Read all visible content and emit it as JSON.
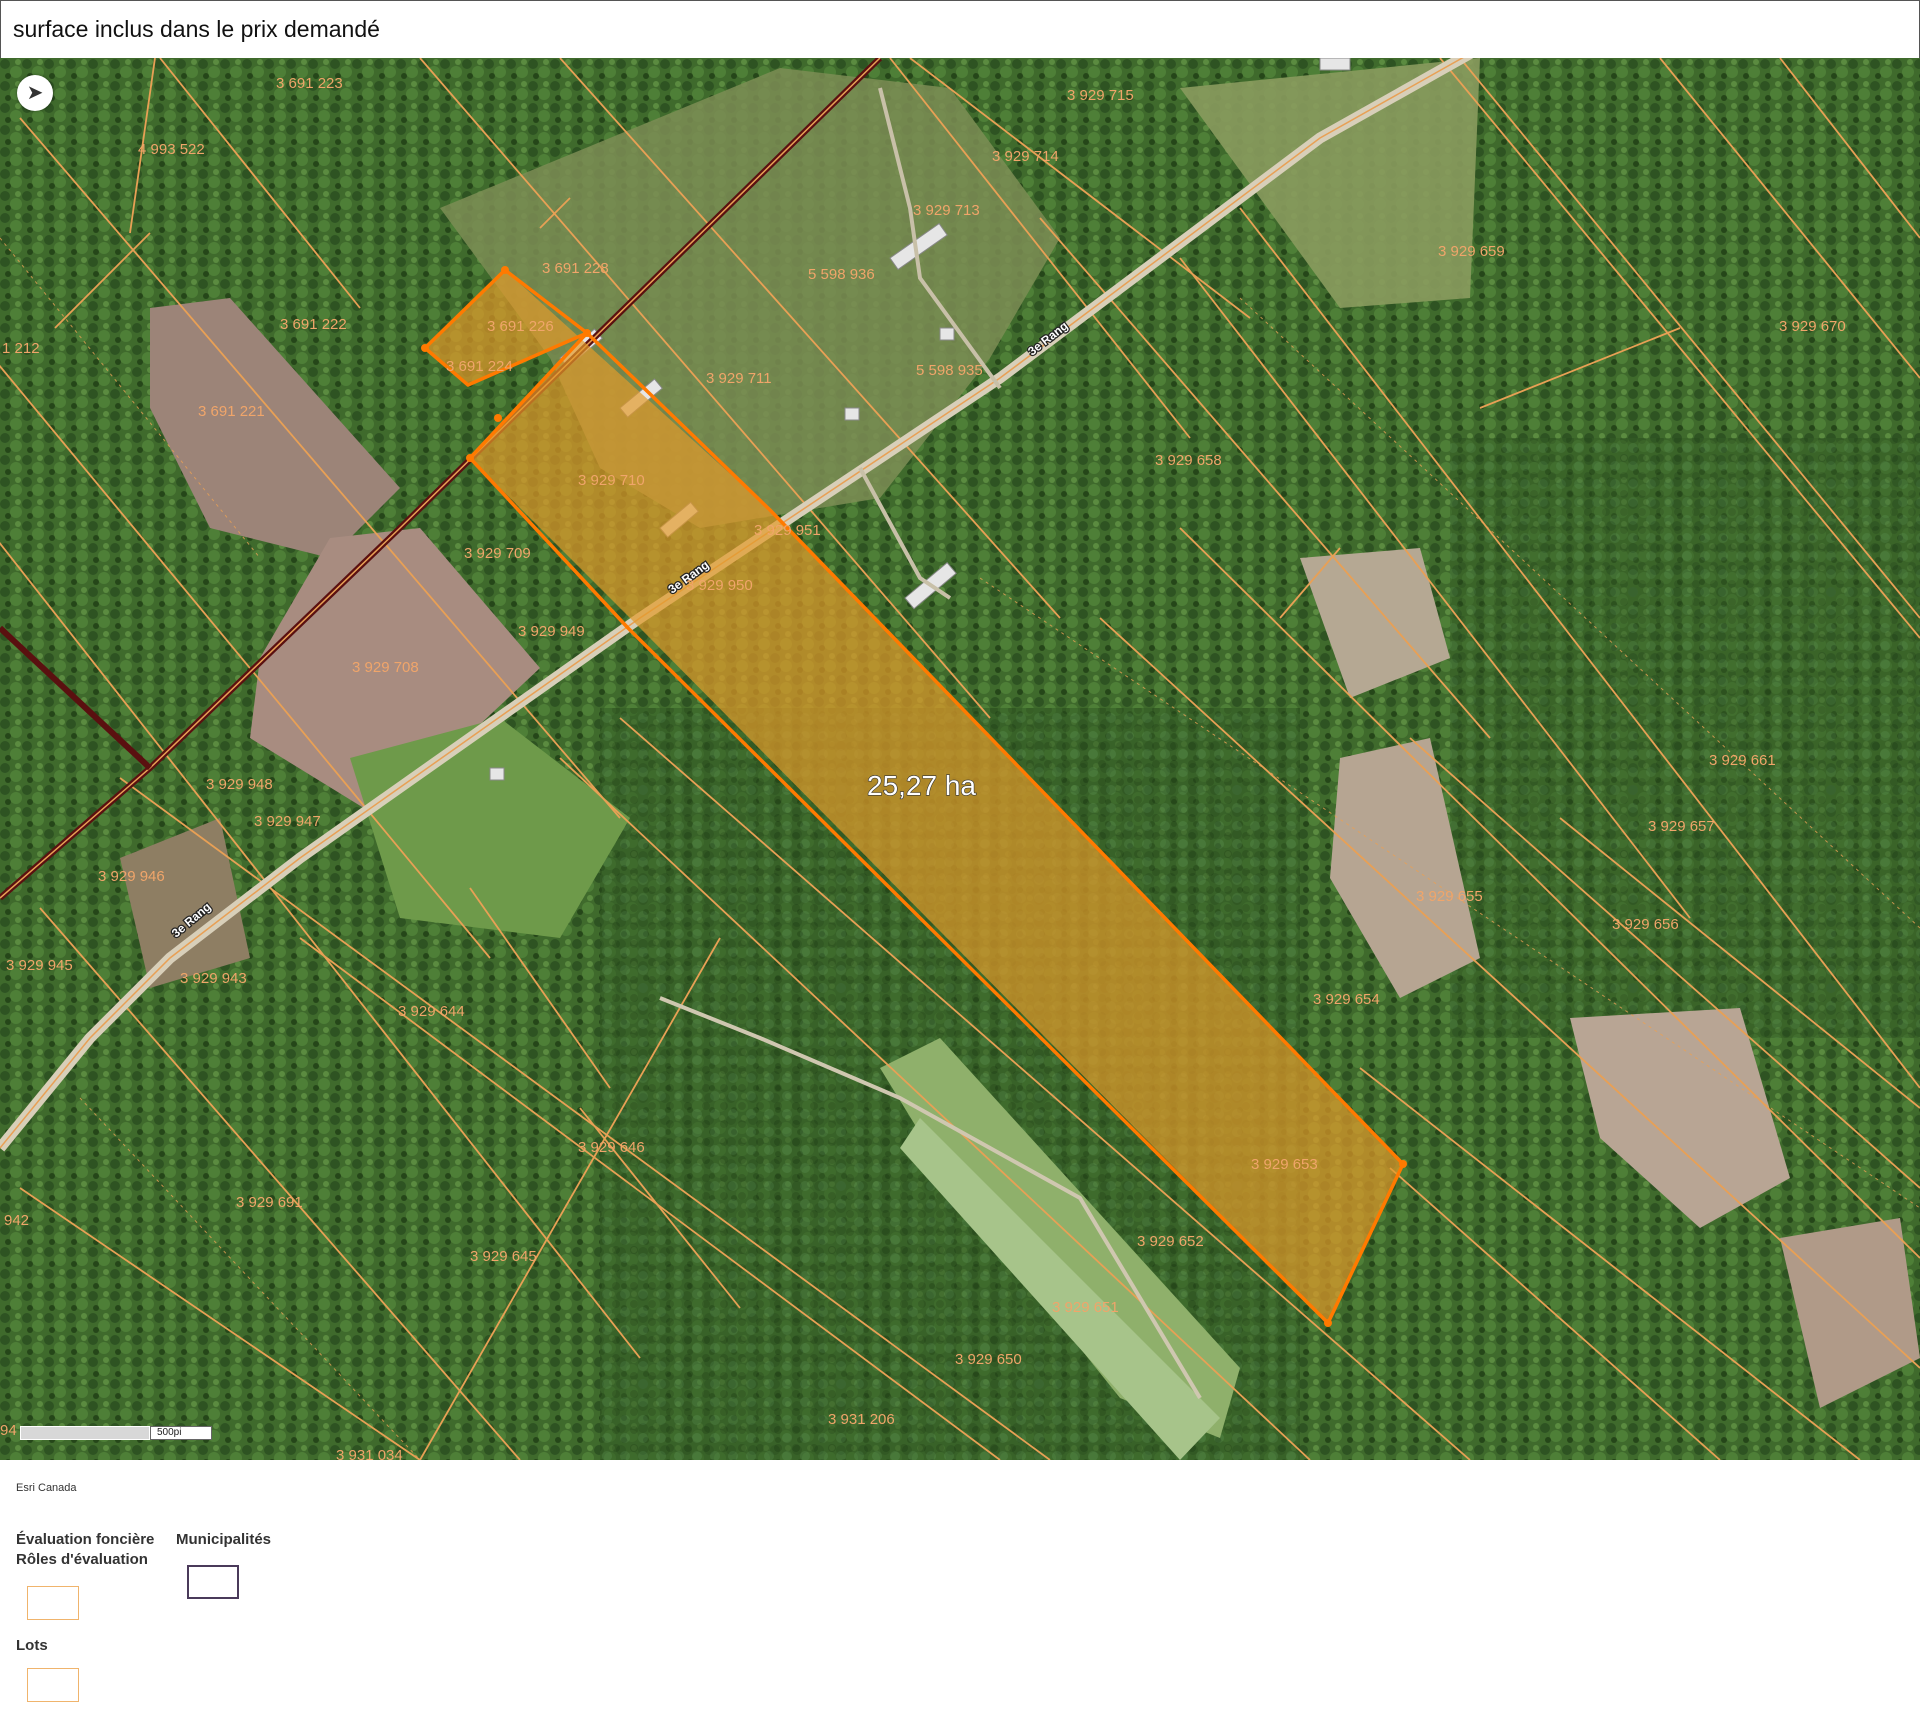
{
  "title": "surface inclus dans le prix demandé",
  "map": {
    "area_label": "25,27 ha",
    "road_label": "3e Rang",
    "lot_labels": [
      "3 691 223",
      "4 993 522",
      "3 691 228",
      "3 691 226",
      "3 691 224",
      "3 691 222",
      "3 691 221",
      "1 212",
      "3 929 715",
      "3 929 714",
      "3 929 713",
      "5 598 936",
      "5 598 935",
      "3 929 711",
      "3 929 710",
      "3 929 709",
      "3 929 951",
      "3 929 950",
      "3 929 949",
      "3 929 708",
      "3 929 948",
      "3 929 947",
      "3 929 946",
      "3 929 945",
      "3 929 943",
      "3 929 644",
      "3 929 646",
      "3 929 691",
      "3 929 645",
      "942",
      "94",
      "3 931 034",
      "3 931 206",
      "3 929 650",
      "3 929 651",
      "3 929 652",
      "3 929 653",
      "3 929 654",
      "3 929 655",
      "3 929 656",
      "3 929 657",
      "3 929 661",
      "3 929 658",
      "3 929 659",
      "3 929 670"
    ],
    "colors": {
      "lot_line": "#e8a055",
      "selected_fill": "#e39a2a",
      "selected_outline": "#ff7a00",
      "municipal_line": "#5a1010"
    },
    "scale_label": "500pi",
    "compass_icon": "compass-icon"
  },
  "attribution": "Esri Canada",
  "legend": {
    "group1_title_line1": "Évaluation foncière",
    "group1_title_line2": "Rôles d'évaluation",
    "group2_title": "Municipalités",
    "group3_title": "Lots"
  }
}
